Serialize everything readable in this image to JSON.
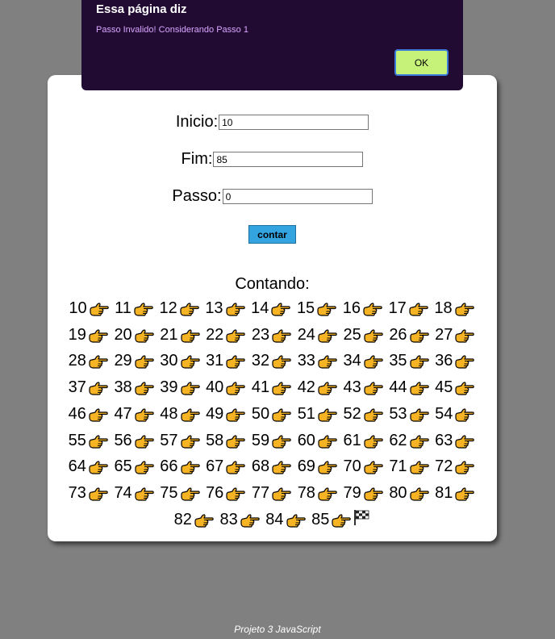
{
  "form": {
    "inicio_label": "Inicio:",
    "inicio_value": "10",
    "fim_label": "Fim:",
    "fim_value": "85",
    "passo_label": "Passo:",
    "passo_value": "0",
    "button_label": "contar"
  },
  "result": {
    "title": "Contando:",
    "numbers": [
      "10",
      "11",
      "12",
      "13",
      "14",
      "15",
      "16",
      "17",
      "18",
      "19",
      "20",
      "21",
      "22",
      "23",
      "24",
      "25",
      "26",
      "27",
      "28",
      "29",
      "30",
      "31",
      "32",
      "33",
      "34",
      "35",
      "36",
      "37",
      "38",
      "39",
      "40",
      "41",
      "42",
      "43",
      "44",
      "45",
      "46",
      "47",
      "48",
      "49",
      "50",
      "51",
      "52",
      "53",
      "54",
      "55",
      "56",
      "57",
      "58",
      "59",
      "60",
      "61",
      "62",
      "63",
      "64",
      "65",
      "66",
      "67",
      "68",
      "69",
      "70",
      "71",
      "72",
      "73",
      "74",
      "75",
      "76",
      "77",
      "78",
      "79",
      "80",
      "81",
      "82",
      "83",
      "84",
      "85"
    ],
    "step_icon": "pointing-hand-icon",
    "end_icon": "checkered-flag-icon"
  },
  "dialog": {
    "title": "Essa página diz",
    "message": "Passo Invalido! Considerando Passo 1",
    "ok_label": "OK"
  },
  "footer": {
    "text": "Projeto 3 JavaScript"
  },
  "colors": {
    "background": "#808080",
    "dialog_bg": "#220b33",
    "dialog_message": "#d9a6ff",
    "ok_button": "#c6f27a",
    "contar_button": "#34a4e0"
  }
}
